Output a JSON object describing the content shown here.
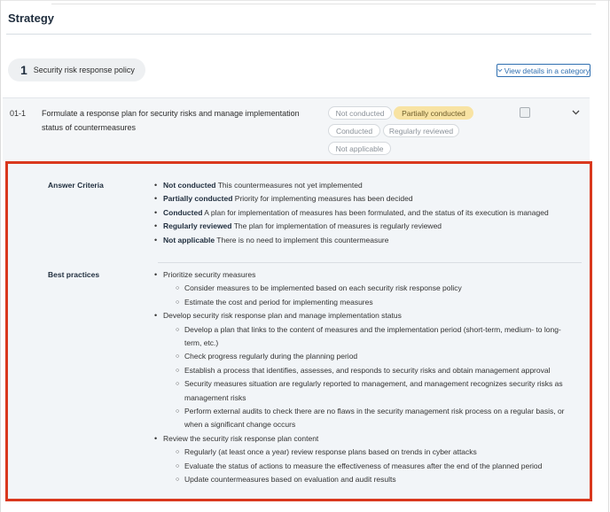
{
  "page": {
    "title": "Strategy"
  },
  "policy": {
    "number": "1",
    "label": "Security risk response policy",
    "view_details_icon": "chevron-down-icon",
    "view_details_label": "View details in a category"
  },
  "item": {
    "id": "01-1",
    "text": "Formulate a response plan for security risks and manage implementation status of countermeasures",
    "options": [
      {
        "label": "Not conducted",
        "selected": false
      },
      {
        "label": "Partially conducted",
        "selected": true
      },
      {
        "label": "Conducted",
        "selected": false
      },
      {
        "label": "Regularly reviewed",
        "selected": false
      },
      {
        "label": "Not applicable",
        "selected": false
      }
    ],
    "checkbox_checked": false,
    "expand_icon": "chevron-down-icon"
  },
  "answer_criteria": {
    "heading": "Answer Criteria",
    "items": [
      {
        "term": "Not conducted",
        "desc": " This countermeasures not yet implemented"
      },
      {
        "term": "Partially conducted",
        "desc": " Priority for implementing measures has been decided"
      },
      {
        "term": "Conducted",
        "desc": " A plan for implementation of measures has been formulated, and the status of its execution is managed"
      },
      {
        "term": "Regularly reviewed",
        "desc": " The plan for implementation of measures is regularly reviewed"
      },
      {
        "term": "Not applicable",
        "desc": " There is no need to implement this countermeasure"
      }
    ]
  },
  "best_practices": {
    "heading": "Best practices",
    "groups": [
      {
        "title": "Prioritize security measures",
        "items": [
          "Consider measures to be implemented based on each security risk response policy",
          "Estimate the cost and period for implementing measures"
        ]
      },
      {
        "title": "Develop security risk response plan and manage implementation status",
        "items": [
          "Develop a plan that links to the content of measures and the implementation period (short-term, medium- to long-term, etc.)",
          "Check progress regularly during the planning period",
          "Establish a process that identifies, assesses, and responds to security risks and obtain management approval",
          "Security measures situation are regularly reported to management, and management recognizes security risks as management risks",
          "Perform external audits to check there are no flaws in the security management risk process on a regular basis, or when a significant change occurs"
        ]
      },
      {
        "title": "Review the security risk response plan content",
        "items": [
          "Regularly (at least once a year) review response plans based on trends in cyber attacks",
          "Evaluate the status of actions to measure the effectiveness of measures after the end of the planned period",
          "Update countermeasures based on evaluation and audit results"
        ]
      }
    ]
  }
}
